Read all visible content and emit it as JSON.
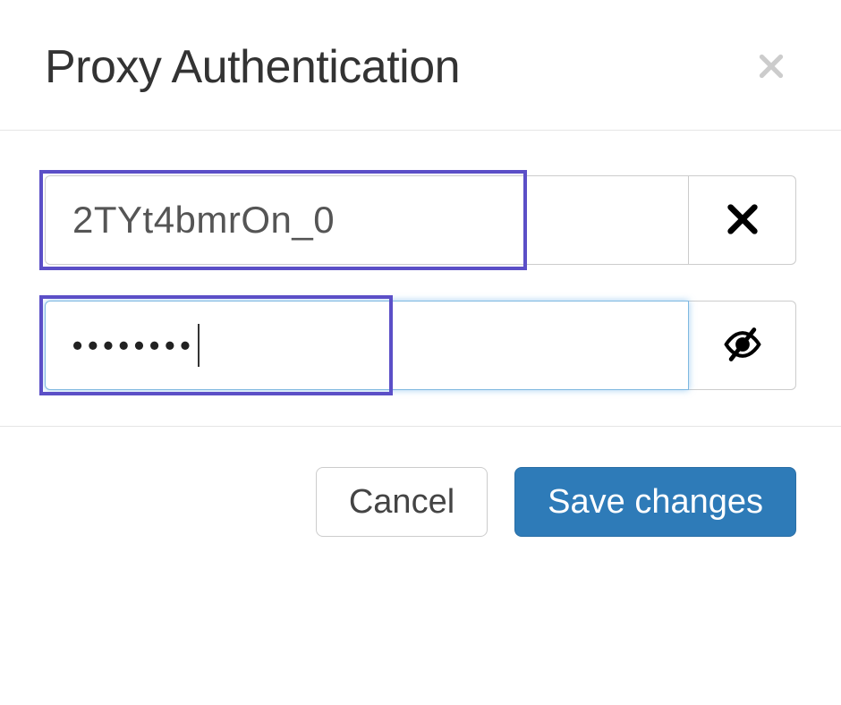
{
  "header": {
    "title": "Proxy Authentication"
  },
  "form": {
    "username": {
      "value": "2TYt4bmrOn_0"
    },
    "password": {
      "masked_value": "••••••••"
    }
  },
  "footer": {
    "cancel_label": "Cancel",
    "save_label": "Save changes"
  },
  "colors": {
    "highlight": "#5b4fc7",
    "primary": "#2e7bb8",
    "focus_border": "#7fb8e0"
  }
}
